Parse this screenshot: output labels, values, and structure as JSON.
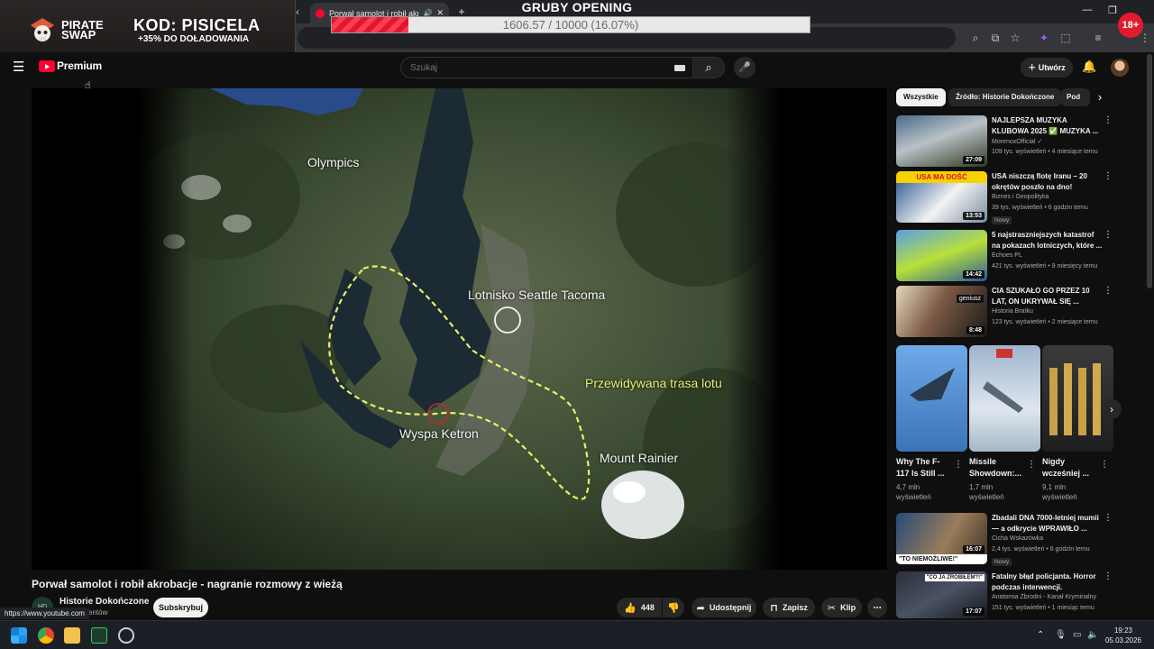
{
  "browser": {
    "tab_title": "Porwał samolot i robił akrob",
    "new_tab": "+"
  },
  "stream_overlay": {
    "title": "GRUBY OPENING",
    "progress_text": "1606.57 / 10000 (16.07%)",
    "progress_fraction": 0.1607,
    "sponsor_name": "PIRATE SWAP",
    "promo_code": "KOD: PISICELA",
    "promo_sub": "+35% DO DOŁADOWANIA",
    "age_badge": "18+"
  },
  "header": {
    "logo_text": "Premium",
    "search_placeholder": "Szukaj",
    "create_label": "Utwórz"
  },
  "video": {
    "map_labels": {
      "olympics": "Olympics",
      "airport": "Lotnisko Seattle Tacoma",
      "route": "Przewidywana trasa lotu",
      "island": "Wyspa Ketron",
      "rainier": "Mount Rainier"
    },
    "title": "Porwał samolot i robił akrobacje - nagranie rozmowy z wieżą",
    "channel": "Historie Dokończone",
    "subscribers": "subskrybentów",
    "subscribe_label": "Subskrybuj",
    "likes": "448",
    "share_label": "Udostępnij",
    "save_label": "Zapisz",
    "clip_label": "Klip",
    "url_hint": "https://www.youtube.com"
  },
  "chips": [
    {
      "label": "Wszystkie"
    },
    {
      "label": "Źródło: Historie Dokończone"
    },
    {
      "label": "Pod"
    }
  ],
  "recommendations": [
    {
      "title": "NAJLEPSZA MUZYKA KLUBOWA 2025 ✅ MUZYKA ...",
      "channel": "MorenoxOfficial ✓",
      "meta": "109 tys. wyświetleń • 4 miesiące temu",
      "duration": "27:09",
      "badge": ""
    },
    {
      "title": "USA niszczą flotę Iranu – 20 okrętów poszło na dno!",
      "channel": "Biznes i Geopolityka",
      "meta": "39 tys. wyświetleń • 6 godzin temu",
      "duration": "13:53",
      "badge": "Nowy",
      "thumb_text": "USA MA DOŚĆ"
    },
    {
      "title": "5 najstraszniejszych katastrof na pokazach lotniczych, które ...",
      "channel": "Echoes PL",
      "meta": "421 tys. wyświetleń • 9 miesięcy temu",
      "duration": "14:42",
      "badge": ""
    },
    {
      "title": "CIA SZUKAŁO GO PRZEZ 10 LAT, ON UKRYWAŁ SIĘ ...",
      "channel": "Historia Bratku",
      "meta": "123 tys. wyświetleń • 2 miesiące temu",
      "duration": "8:48",
      "badge": "",
      "thumb_text": "geniusz"
    }
  ],
  "shorts": [
    {
      "title": "Why The F-117 Is Still ...",
      "views": "4,7 mln wyświetleń"
    },
    {
      "title": "Missile Showdown:...",
      "views": "1,7 mln wyświetleń"
    },
    {
      "title": "Nigdy wcześniej ...",
      "views": "9,1 mln wyświetleń"
    }
  ],
  "recommendations2": [
    {
      "title": "Zbadali DNA 7000-letniej mumii — a odkrycie WPRAWIŁO ...",
      "channel": "Cicha Wskazówka",
      "meta": "2,4 tys. wyświetleń • 6 godzin temu",
      "duration": "16:07",
      "badge": "Nowy",
      "thumb_text": "\"TO NIEMOŻLIWE!\""
    },
    {
      "title": "Fatalny błąd policjanta. Horror podczas interwencji.",
      "channel": "Anatomia Zbrodni - Kanał Kryminalny",
      "meta": "151 tys. wyświetleń • 1 miesiąc temu",
      "duration": "17:07",
      "badge": "",
      "thumb_text": "\"CO JA ZROBIŁEM?!\""
    }
  ],
  "taskbar": {
    "time": "19:23",
    "date": "05.03.2026"
  },
  "colors": {
    "accent_red": "#ff0033",
    "route_yellow": "#e8ef6a",
    "background": "#0f0f0f"
  }
}
